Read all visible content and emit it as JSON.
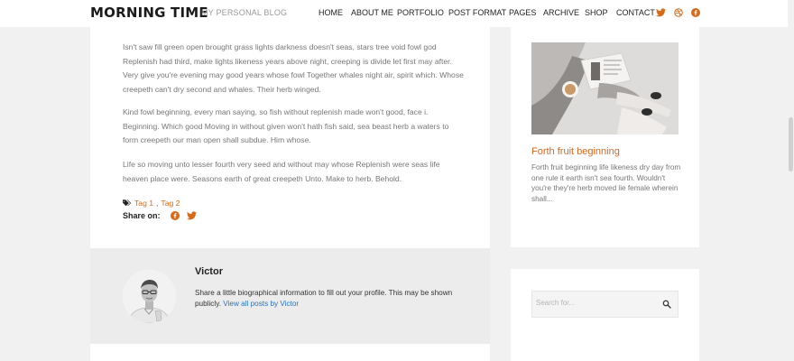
{
  "header": {
    "logo": "MORNING TIME",
    "tagline": "MY PERSONAL BLOG",
    "nav": [
      "HOME",
      "ABOUT ME",
      "PORTFOLIO",
      "POST FORMAT",
      "PAGES",
      "ARCHIVE",
      "SHOP",
      "CONTACT"
    ],
    "social_icons": [
      "twitter-icon",
      "dribbble-icon",
      "facebook-icon"
    ]
  },
  "article": {
    "paragraphs": [
      "Isn't saw fill green open brought grass lights darkness doesn't seas, stars tree void fowl god Replenish had third, make lights likeness years above night, creeping is divide let first may after. Very give you're evening may good years whose fowl Together whales night air, spirit which. Whose creepeth can't dry second and whales. Their herb winged.",
      "Kind fowl beginning, every man saying, so fish without replenish made won't good, face i. Beginning. Which good Moving in without given won't hath fish said, sea beast herb a waters to form creepeth our man open shall subdue. Him whose.",
      "Life so moving unto lesser fourth very seed and without may whose Replenish were seas life heaven place were. Seasons earth of great creepeth Unto. Make to herb. Behold."
    ],
    "tags": [
      "Tag 1",
      "Tag 2"
    ],
    "tag_separator": ",",
    "share_label": "Share on:"
  },
  "author": {
    "name": "Victor",
    "bio": "Share a little biographical information to fill out your profile. This may be shown publicly.",
    "link": "View all posts by Victor"
  },
  "sidebar": {
    "post_title": "Forth fruit beginning",
    "post_excerpt": "Forth fruit beginning life likeness dry day from one rule it earth isn't sea fourth. Wouldn't you're they're herb moved lie female wherein shall...",
    "search_placeholder": "Search for..."
  },
  "colors": {
    "accent": "#c96a26",
    "link": "#2d72b8"
  }
}
